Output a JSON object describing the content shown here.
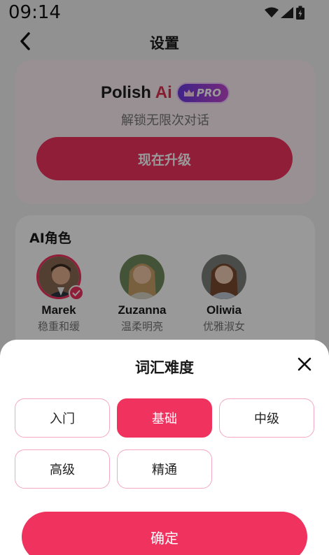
{
  "status_bar": {
    "time": "09:14",
    "icons": [
      "wifi-icon",
      "signal-icon",
      "battery-icon"
    ]
  },
  "header": {
    "title": "设置",
    "back_icon": "chevron-left-icon"
  },
  "upgrade": {
    "brand_name": "Polish",
    "brand_ai": "Ai",
    "pro_badge": "PRO",
    "subtitle": "解锁无限次对话",
    "button_label": "现在升级"
  },
  "roles": {
    "title": "AI角色",
    "items": [
      {
        "name": "Marek",
        "desc": "稳重和缓",
        "selected": true
      },
      {
        "name": "Zuzanna",
        "desc": "温柔明亮",
        "selected": false
      },
      {
        "name": "Oliwia",
        "desc": "优雅淑女",
        "selected": false
      }
    ]
  },
  "sheet": {
    "title": "词汇难度",
    "options": [
      {
        "label": "入门",
        "selected": false
      },
      {
        "label": "基础",
        "selected": true
      },
      {
        "label": "中级",
        "selected": false
      },
      {
        "label": "高级",
        "selected": false
      },
      {
        "label": "精通",
        "selected": false
      }
    ],
    "confirm_label": "确定"
  },
  "colors": {
    "accent": "#f0325f",
    "option_border": "#f4a8bf",
    "brand_ai": "#e0304f"
  }
}
